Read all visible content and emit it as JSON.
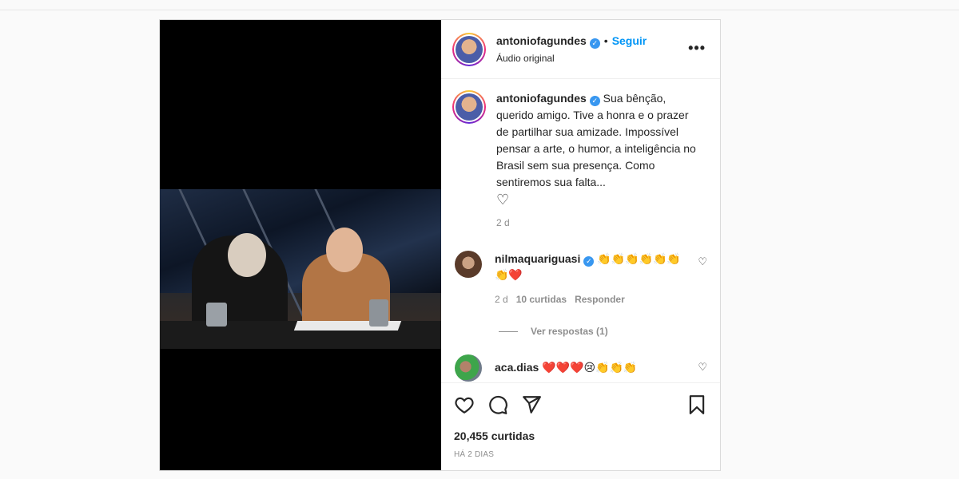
{
  "post": {
    "author": "antoniofagundes",
    "follow_label": "Seguir",
    "separator": "•",
    "audio": "Áudio original",
    "more_label": "•••"
  },
  "caption": {
    "author": "antoniofagundes",
    "text": "Sua bênção, querido amigo. Tive a honra e o prazer de partilhar sua amizade. Impossível pensar a arte, o humor, a inteligência no Brasil sem sua presença. Como sentiremos sua falta...",
    "emoji": "♡",
    "time": "2 d"
  },
  "comments": [
    {
      "author": "nilmaquariguasi",
      "text": "👏👏👏👏👏👏👏❤️",
      "time": "2 d",
      "likes": "10 curtidas",
      "reply_label": "Responder",
      "view_replies": "Ver respostas (1)"
    },
    {
      "author": "aca.dias",
      "text": "❤️❤️❤️😢👏👏👏"
    }
  ],
  "stats": {
    "likes": "20,455 curtidas",
    "when": "HÁ 2 DIAS"
  },
  "icons": {
    "verified": "✓",
    "comment_heart": "♡"
  },
  "colors": {
    "link": "#0095f6",
    "verified": "#3897f0"
  }
}
